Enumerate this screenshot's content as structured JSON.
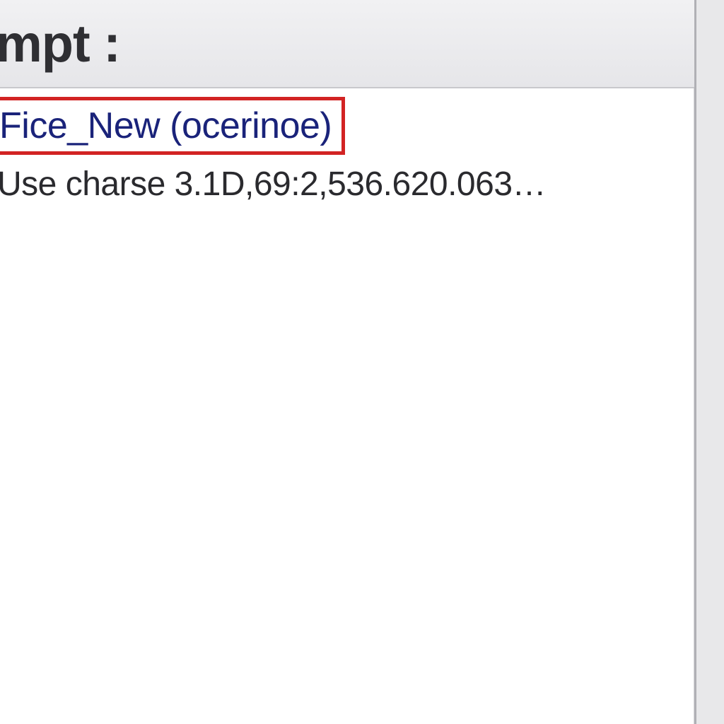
{
  "header": {
    "title_fragment": "mpt :"
  },
  "content": {
    "highlighted_entry": "Fice_New (ocerinoe)",
    "detail_line": "Use charse 3.1D,69:2,536.620.063…"
  },
  "colors": {
    "highlight_border": "#d22323",
    "link_text": "#1a237a",
    "header_bg_top": "#f1f1f3",
    "header_bg_bottom": "#e6e6e9"
  }
}
